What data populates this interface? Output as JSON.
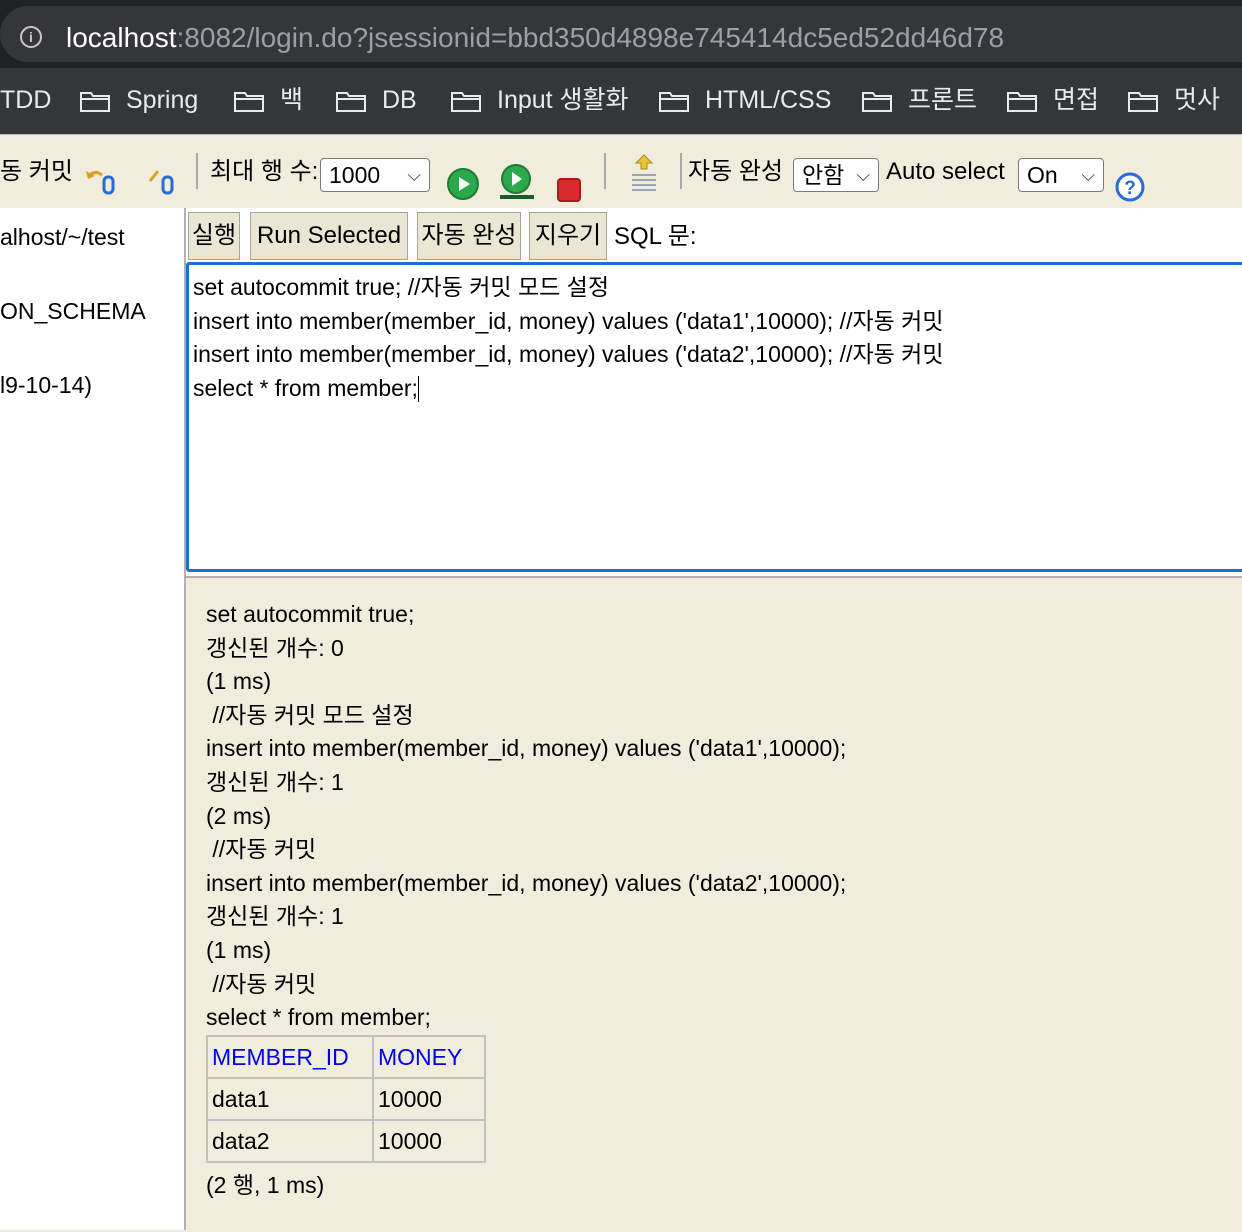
{
  "browser": {
    "url_host": "localhost",
    "url_rest": ":8082/login.do?jsessionid=bbd350d4898e745414dc5ed52dd46d78",
    "bookmarks": [
      "TDD",
      "Spring",
      "백",
      "DB",
      "Input 생활화",
      "HTML/CSS",
      "프론트",
      "면접",
      "멋사"
    ]
  },
  "toolbar": {
    "autocommit_label": "동 커밋",
    "max_rows_label": "최대 행 수:",
    "max_rows_value": "1000",
    "autocomplete_label": "자동 완성",
    "autocomplete_value": "안함",
    "auto_select_label": "Auto select",
    "auto_select_value": "On",
    "help_icon": "?"
  },
  "tree": {
    "items": [
      "alhost/~/test",
      "ON_SCHEMA",
      "l9-10-14)"
    ]
  },
  "query": {
    "buttons": [
      "실행",
      "Run Selected",
      "자동 완성",
      "지우기"
    ],
    "sql_label": "SQL 문:",
    "lines": [
      "set autocommit true; //자동 커밋 모드 설정",
      "insert into member(member_id, money) values ('data1',10000); //자동 커밋",
      "insert into member(member_id, money) values ('data2',10000); //자동 커밋",
      "select * from member;"
    ]
  },
  "results": {
    "lines": [
      "set autocommit true;",
      "갱신된 개수: 0",
      "(1 ms)",
      " //자동 커밋 모드 설정",
      "insert into member(member_id, money) values ('data1',10000);",
      "갱신된 개수: 1",
      "(2 ms)",
      " //자동 커밋",
      "insert into member(member_id, money) values ('data2',10000);",
      "갱신된 개수: 1",
      "(1 ms)",
      " //자동 커밋",
      "select * from member;"
    ],
    "table": {
      "columns": [
        "MEMBER_ID",
        "MONEY"
      ],
      "rows": [
        [
          "data1",
          "10000"
        ],
        [
          "data2",
          "10000"
        ]
      ]
    },
    "footer": "(2 행, 1 ms)"
  },
  "colors": {
    "editor_border": "#1f6fd1",
    "header_link": "#0000ee",
    "panel_bg": "#f0eddc"
  }
}
